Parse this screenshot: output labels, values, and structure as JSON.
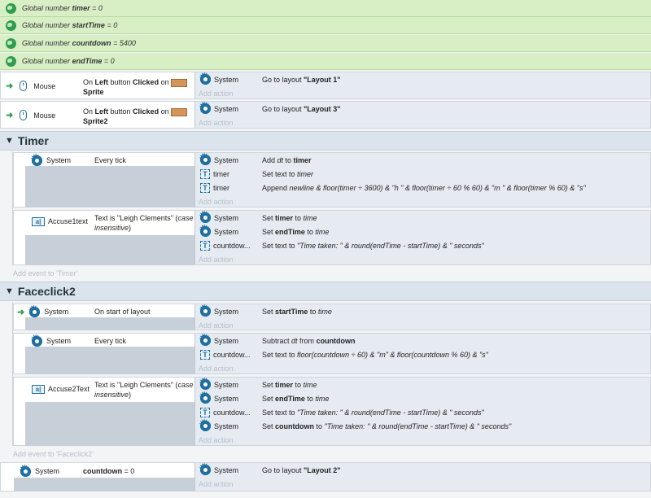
{
  "globals": [
    {
      "prefix": "Global number",
      "name": "timer",
      "value": "= 0"
    },
    {
      "prefix": "Global number",
      "name": "startTime",
      "value": "= 0"
    },
    {
      "prefix": "Global number",
      "name": "countdown",
      "value": "= 5400"
    },
    {
      "prefix": "Global number",
      "name": "endTime",
      "value": "= 0"
    }
  ],
  "common": {
    "system": "System",
    "add_action": "Add action"
  },
  "events": {
    "e1": {
      "object": "Mouse",
      "cond_pre": "On ",
      "cond_b1": "Left",
      "cond_mid": " button ",
      "cond_b2": "Clicked",
      "cond_post": " on",
      "target": "Sprite",
      "act_pre": "Go to layout ",
      "act_b": "\"Layout 1\""
    },
    "e2": {
      "object": "Mouse",
      "cond_pre": "On ",
      "cond_b1": "Left",
      "cond_mid": " button ",
      "cond_b2": "Clicked",
      "cond_post": " on",
      "target": "Sprite2",
      "act_pre": "Go to layout ",
      "act_b": "\"Layout 3\""
    }
  },
  "timer_group": {
    "title": "Timer",
    "ev1": {
      "cond_text": "Every tick",
      "a1": {
        "pre": "Add ",
        "i1": "dt",
        "mid": " to ",
        "b": "timer"
      },
      "a2": {
        "obj": "timer",
        "pre": "Set text to ",
        "i": "timer"
      },
      "a3": {
        "obj": "timer",
        "pre": "Append ",
        "i": "newline & floor(timer ÷ 3600) & \"h \" & floor(timer ÷ 60 % 60) & \"m \" & floor(timer % 60) & \"s\""
      }
    },
    "ev2": {
      "object": "Accuse1text",
      "cond_pre": "Text is \"Leigh Clements\" (",
      "cond_i1": "case",
      "cond_i2": "insensitive",
      "cond_post": ")",
      "a1": {
        "pre": "Set ",
        "b": "timer",
        "mid": " to ",
        "i": "time"
      },
      "a2": {
        "pre": "Set ",
        "b": "endTime",
        "mid": " to ",
        "i": "time"
      },
      "a3": {
        "obj": "countdow...",
        "pre": "Set text to ",
        "i": "\"Time taken: \" & round(endTime - startTime) & \" seconds\""
      }
    },
    "add_event": "Add event to 'Timer'"
  },
  "faceclick_group": {
    "title": "Faceclick2",
    "ev1": {
      "cond_text": "On start of layout",
      "a1": {
        "pre": "Set ",
        "b": "startTime",
        "mid": " to ",
        "i": "time"
      }
    },
    "ev2": {
      "cond_text": "Every tick",
      "a1": {
        "pre": "Subtract ",
        "i1": "dt",
        "mid": " from ",
        "b": "countdown"
      },
      "a2": {
        "obj": "countdow...",
        "pre": "Set text to ",
        "i": "floor(countdown ÷ 60) & \"m\" & floor(countdown % 60) & \"s\""
      }
    },
    "ev3": {
      "object": "Accuse2Text",
      "cond_pre": "Text is \"Leigh Clements\" (",
      "cond_i1": "case",
      "cond_i2": "insensitive",
      "cond_post": ")",
      "a1": {
        "pre": "Set ",
        "b": "timer",
        "mid": " to ",
        "i": "time"
      },
      "a2": {
        "pre": "Set ",
        "b": "endTime",
        "mid": " to ",
        "i": "time"
      },
      "a3": {
        "obj": "countdow...",
        "pre": "Set text to ",
        "i": "\"Time taken: \" & round(endTime - startTime) & \" seconds\""
      },
      "a4": {
        "pre": "Set ",
        "b": "countdown",
        "mid": " to ",
        "i": "\"Time taken: \" & round(endTime - startTime) & \" seconds\""
      }
    },
    "add_event": "Add event to 'Faceclick2'"
  },
  "last_event": {
    "cond_b": "countdown",
    "cond_post": " = 0",
    "act_pre": "Go to layout ",
    "act_b": "\"Layout 2\""
  }
}
